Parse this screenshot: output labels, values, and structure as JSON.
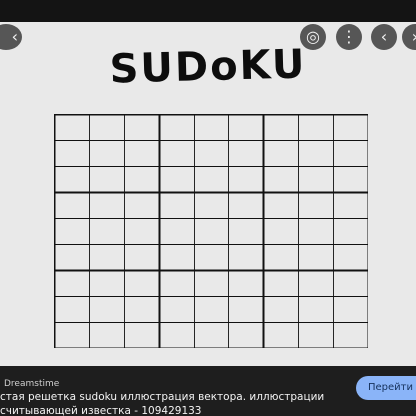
{
  "viewer": {
    "logo_text": "SUDoKU",
    "grid_rows": 9,
    "grid_cols": 9
  },
  "controls": {
    "back_glyph": "‹",
    "lens_glyph": "◎",
    "more_glyph": "⋮",
    "prev_glyph": "‹",
    "next_glyph": "›"
  },
  "caption": {
    "source": "Dreamstime",
    "title_line1": "стая решетка sudoku иллюстрация вектора. иллюстрации",
    "title_line2": "считывающей известка - 109429133",
    "visit_label": "Перейти"
  },
  "colors": {
    "viewer_bg": "#e9e9e9",
    "grid_line": "#111111",
    "visit_button": "#8ab4f8"
  }
}
